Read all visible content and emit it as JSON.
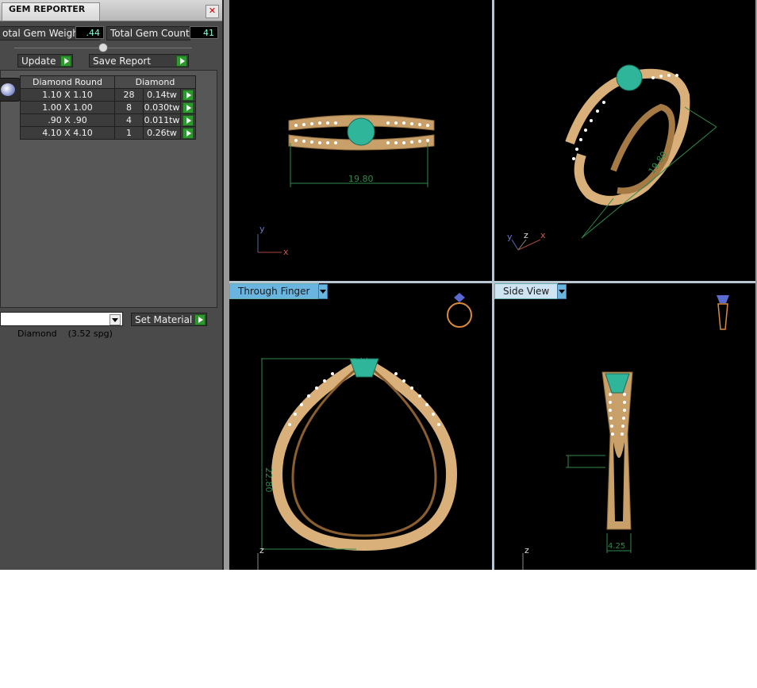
{
  "panel": {
    "title": "GEM REPORTER",
    "close_glyph": "✕",
    "total_weight_label": "otal Gem Weight",
    "total_weight_value": ".44",
    "total_count_label": "Total Gem Count",
    "total_count_value": "41",
    "update_label": "Update",
    "save_report_label": "Save Report",
    "gem_icon": "diamond-gem-icon"
  },
  "gem_table": {
    "headers": [
      "Diamond Round",
      "Diamond"
    ],
    "rows": [
      {
        "size": "1.10 X 1.10",
        "count": "28",
        "weight": "0.14tw"
      },
      {
        "size": "1.00 X 1.00",
        "count": "8",
        "weight": "0.030tw"
      },
      {
        "size": ".90 X .90",
        "count": "4",
        "weight": "0.011tw"
      },
      {
        "size": "4.10 X 4.10",
        "count": "1",
        "weight": "0.26tw"
      }
    ]
  },
  "material": {
    "selected": "Diamond    (3.52 spg)",
    "set_label": "Set Material"
  },
  "viewports": {
    "top_left": {
      "dimension": "19.80",
      "axis_y": "y",
      "axis_x": "x"
    },
    "top_right": {
      "dimension": "19.80",
      "axis_y": "y",
      "axis_z": "z",
      "axis_x": "x"
    },
    "bottom_left": {
      "label": "Through Finger",
      "dimension": "22.80",
      "axis_z": "z"
    },
    "bottom_right": {
      "label": "Side View",
      "dimension": "4.25",
      "axis_z": "z"
    }
  },
  "colors": {
    "viewport_bg": "#000000",
    "label_bg": "#6ab4e0",
    "gold": "#d9b07a",
    "emerald": "#2fb59a",
    "dimension": "#2f8a4a",
    "play_green": "#2e9a2e"
  }
}
